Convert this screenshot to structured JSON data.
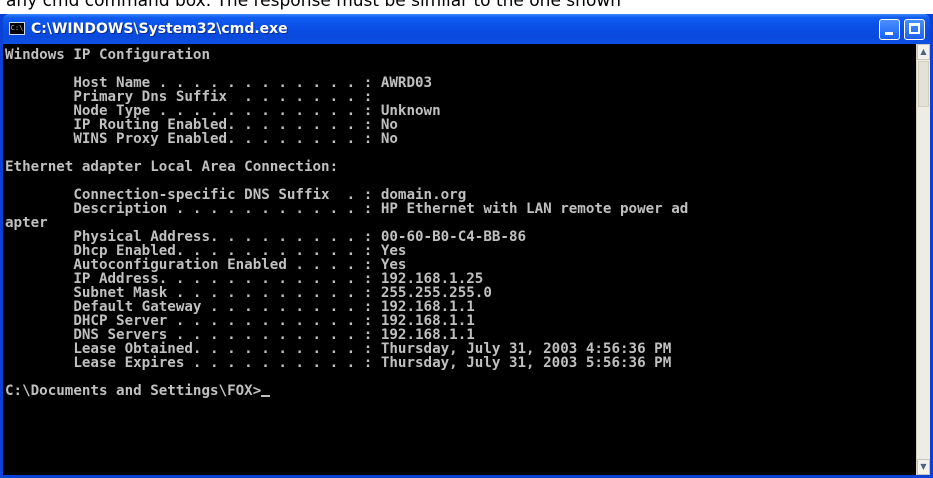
{
  "page_caption": "any cmd command box. The response must be similar to the one shown",
  "window": {
    "title": "C:\\WINDOWS\\System32\\cmd.exe",
    "icon": "console-icon",
    "icon_glyph": "C:\\",
    "title_bar_color": "#0a4fe6",
    "console_background": "#000000",
    "console_foreground": "#c0c0c0"
  },
  "console": {
    "lines": [
      "Windows IP Configuration",
      "",
      "        Host Name . . . . . . . . . . . . : AWRD03",
      "        Primary Dns Suffix  . . . . . . . :",
      "        Node Type . . . . . . . . . . . . : Unknown",
      "        IP Routing Enabled. . . . . . . . : No",
      "        WINS Proxy Enabled. . . . . . . . : No",
      "",
      "Ethernet adapter Local Area Connection:",
      "",
      "        Connection-specific DNS Suffix  . : domain.org",
      "        Description . . . . . . . . . . . : HP Ethernet with LAN remote power ad",
      "apter",
      "        Physical Address. . . . . . . . . : 00-60-B0-C4-BB-86",
      "        Dhcp Enabled. . . . . . . . . . . : Yes",
      "        Autoconfiguration Enabled . . . . : Yes",
      "        IP Address. . . . . . . . . . . . : 192.168.1.25",
      "        Subnet Mask . . . . . . . . . . . : 255.255.255.0",
      "        Default Gateway . . . . . . . . . : 192.168.1.1",
      "        DHCP Server . . . . . . . . . . . : 192.168.1.1",
      "        DNS Servers . . . . . . . . . . . : 192.168.1.1",
      "        Lease Obtained. . . . . . . . . . : Thursday, July 31, 2003 4:56:36 PM",
      "        Lease Expires . . . . . . . . . . : Thursday, July 31, 2003 5:56:36 PM",
      ""
    ],
    "prompt": "C:\\Documents and Settings\\FOX>"
  },
  "scrollbar": {
    "up_icon": "scroll-up-arrow-icon",
    "down_icon": "scroll-down-arrow-icon"
  }
}
